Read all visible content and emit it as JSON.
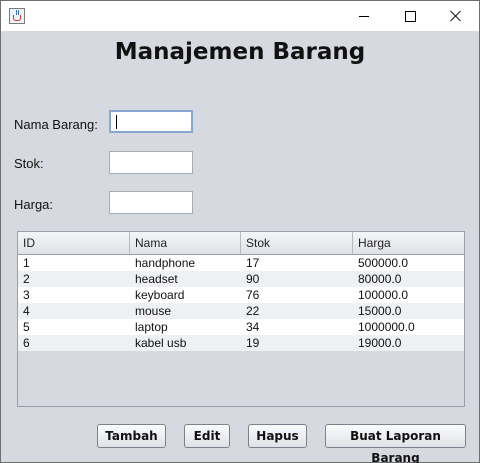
{
  "window": {
    "controls": {
      "minimize": "minimize-icon",
      "maximize": "maximize-icon",
      "close": "close-icon"
    }
  },
  "form": {
    "title": "Manajemen Barang",
    "nama_label": "Nama Barang:",
    "stok_label": "Stok:",
    "harga_label": "Harga:",
    "nama_value": "",
    "stok_value": "",
    "harga_value": ""
  },
  "table": {
    "headers": [
      "ID",
      "Nama",
      "Stok",
      "Harga"
    ],
    "rows": [
      [
        "1",
        "handphone",
        "17",
        "500000.0"
      ],
      [
        "2",
        "headset",
        "90",
        "80000.0"
      ],
      [
        "3",
        "keyboard",
        "76",
        "100000.0"
      ],
      [
        "4",
        "mouse",
        "22",
        "15000.0"
      ],
      [
        "5",
        "laptop",
        "34",
        "1000000.0"
      ],
      [
        "6",
        "kabel usb",
        "19",
        "19000.0"
      ]
    ]
  },
  "buttons": {
    "tambah": "Tambah",
    "edit": "Edit",
    "hapus": "Hapus",
    "laporan": "Buat Laporan Barang"
  }
}
